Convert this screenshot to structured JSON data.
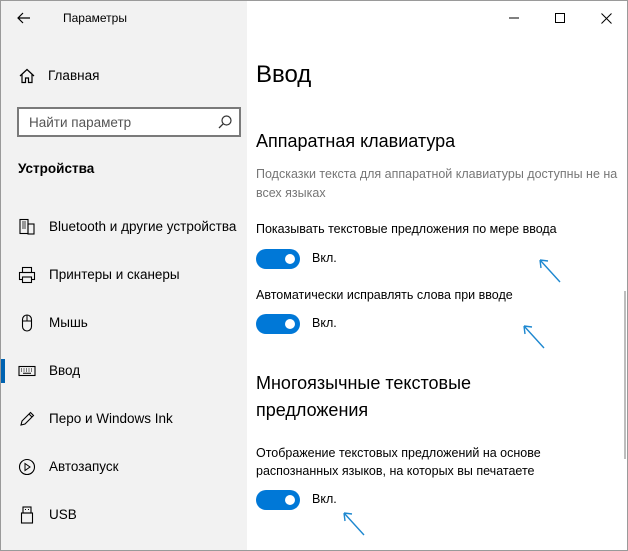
{
  "window": {
    "title": "Параметры"
  },
  "sidebar": {
    "home_label": "Главная",
    "search_placeholder": "Найти параметр",
    "section_title": "Устройства",
    "items": [
      {
        "label": "Bluetooth и другие устройства",
        "icon": "bluetooth-devices-icon"
      },
      {
        "label": "Принтеры и сканеры",
        "icon": "printer-icon"
      },
      {
        "label": "Мышь",
        "icon": "mouse-icon"
      },
      {
        "label": "Ввод",
        "icon": "keyboard-icon",
        "selected": true
      },
      {
        "label": "Перо и Windows Ink",
        "icon": "pen-icon"
      },
      {
        "label": "Автозапуск",
        "icon": "autoplay-icon"
      },
      {
        "label": "USB",
        "icon": "usb-icon"
      }
    ]
  },
  "main": {
    "page_title": "Ввод",
    "hardware_section": {
      "title": "Аппаратная клавиатура",
      "description": "Подсказки текста для аппаратной клавиатуры доступны не на всех языках",
      "options": [
        {
          "label": "Показывать текстовые предложения по мере ввода",
          "state": "Вкл.",
          "on": true
        },
        {
          "label": "Автоматически исправлять слова при вводе",
          "state": "Вкл.",
          "on": true
        }
      ]
    },
    "multilingual_section": {
      "title_line1": "Многоязычные текстовые",
      "title_line2": "предложения",
      "options": [
        {
          "label_line1": "Отображение текстовых предложений на основе",
          "label_line2": "распознанных языков, на которых вы печатаете",
          "state": "Вкл.",
          "on": true
        }
      ]
    }
  },
  "colors": {
    "accent": "#0078d7",
    "sidebar_bg": "#f2f2f2",
    "secondary_text": "#767676",
    "selection_indicator": "#0063b1",
    "annotation_arrow": "#1e88d0"
  }
}
